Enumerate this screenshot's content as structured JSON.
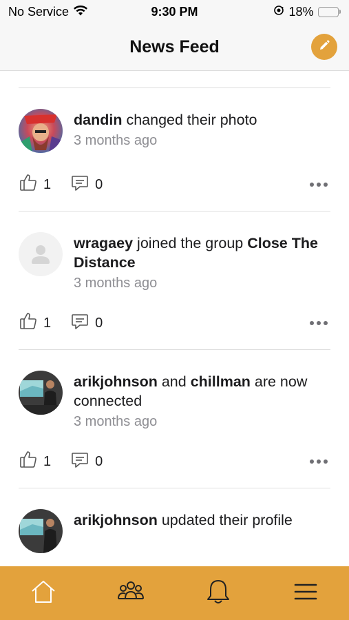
{
  "status_bar": {
    "carrier": "No Service",
    "time": "9:30 PM",
    "battery": "18%",
    "battery_level": 0.18
  },
  "header": {
    "title": "News Feed",
    "compose_icon": "pencil-icon"
  },
  "feed": [
    {
      "avatar": "photo-avatar",
      "actor": "dandin",
      "text": " changed their photo",
      "time": "3 months ago",
      "likes": "1",
      "comments": "0"
    },
    {
      "avatar": "placeholder-avatar",
      "actor": "wragaey",
      "text": " joined the group ",
      "target": "Close The Distance",
      "time": "3 months ago",
      "likes": "1",
      "comments": "0"
    },
    {
      "avatar": "photo-avatar",
      "actor": "arikjohnson",
      "text": " and ",
      "actor2": "chillman",
      "text2": " are now connected",
      "time": "3 months ago",
      "likes": "1",
      "comments": "0"
    },
    {
      "avatar": "photo-avatar",
      "actor": "arikjohnson",
      "text": " updated their profile"
    }
  ],
  "tabbar": {
    "items": [
      "home-icon",
      "groups-icon",
      "bell-icon",
      "menu-icon"
    ]
  },
  "colors": {
    "accent": "#e3a23c",
    "muted_text": "#8e8e93",
    "divider": "#dedede"
  }
}
